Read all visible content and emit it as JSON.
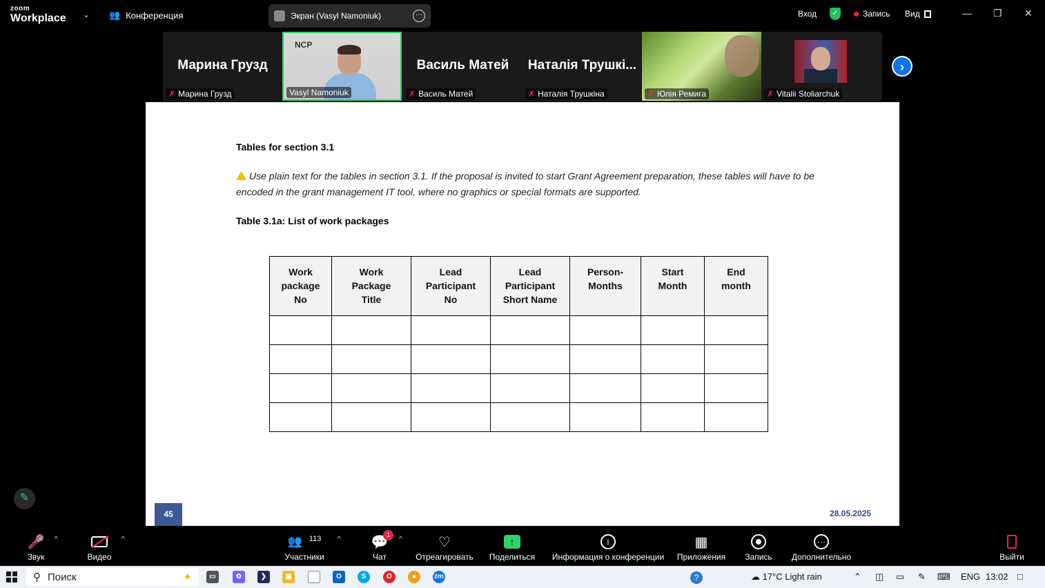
{
  "app": {
    "logo_small": "zoom",
    "logo_big": "Workplace"
  },
  "topbar": {
    "meeting_label": "Конференция",
    "screen_share_label": "Экран (Vasyl Namoniuk)",
    "login": "Вход",
    "recording": "Запись",
    "view": "Вид"
  },
  "participants": [
    {
      "big_name": "Марина Грузд",
      "label": "Марина Грузд",
      "muted": true
    },
    {
      "big_name": "",
      "label": "Vasyl Namoniuk",
      "muted": false,
      "video": true,
      "logo_text": "NCP"
    },
    {
      "big_name": "Василь Матей",
      "label": "Василь Матей",
      "muted": true
    },
    {
      "big_name": "Наталія Трушкі...",
      "label": "Наталія Трушкіна",
      "muted": true
    },
    {
      "big_name": "",
      "label": "Юлія Ремига",
      "muted": true,
      "video": true
    },
    {
      "big_name": "",
      "label": "Vitalii Stoliarchuk",
      "muted": true,
      "video": true
    }
  ],
  "document": {
    "section_title": "Tables for section 3.1",
    "note": "Use plain text for the tables in section 3.1. If the proposal is invited to start Grant Agreement preparation, these tables will have to be encoded in the grant management IT tool, where no graphics or special formats are supported.",
    "table_title": "Table 3.1a: List of work packages",
    "table_headers": [
      "Work package No",
      "Work Package Title",
      "Lead Participant No",
      "Lead Participant Short Name",
      "Person-Months",
      "Start Month",
      "End month"
    ],
    "header_lines": [
      [
        "Work",
        "package",
        "No"
      ],
      [
        "Work",
        "Package",
        "Title"
      ],
      [
        "Lead",
        "Participant",
        "No"
      ],
      [
        "Lead",
        "Participant",
        "Short Name"
      ],
      [
        "Person-",
        "Months"
      ],
      [
        "Start",
        "Month"
      ],
      [
        "End",
        "month"
      ]
    ],
    "empty_rows": 4,
    "page_number": "45",
    "date": "28.05.2025"
  },
  "toolbar": {
    "audio": "Звук",
    "video": "Видео",
    "participants": "Участники",
    "participants_count": "113",
    "chat": "Чат",
    "chat_badge": "1",
    "react": "Отреагировать",
    "share": "Поделиться",
    "info": "Информация о конференции",
    "apps": "Приложения",
    "record": "Запись",
    "more": "Дополнительно",
    "leave": "Выйти"
  },
  "taskbar": {
    "search_placeholder": "Поиск",
    "weather": "17°C  Light rain",
    "lang": "ENG",
    "time": "13:02"
  },
  "colors": {
    "accent_green": "#2ed26b",
    "zoom_blue": "#0e72ed",
    "leave_red": "#e8254b",
    "page_badge": "#3d5a96"
  }
}
